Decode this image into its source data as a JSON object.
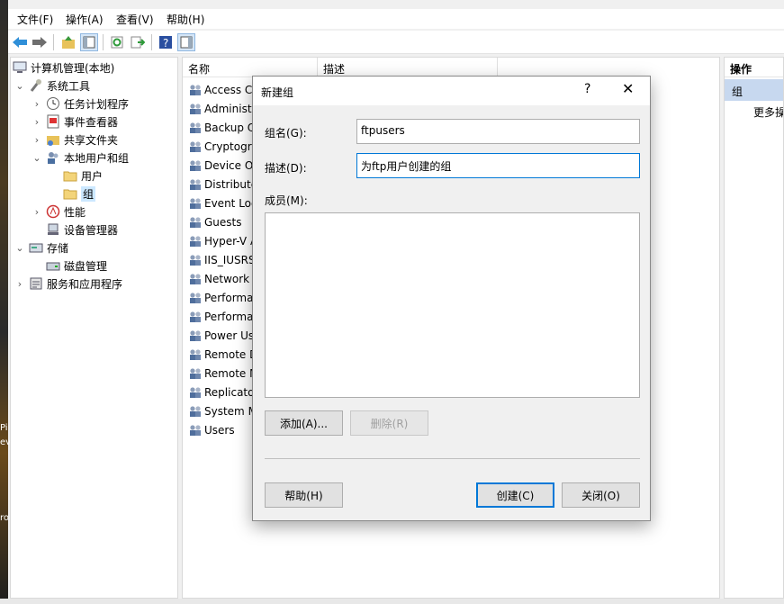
{
  "menubar": {
    "file": "文件(F)",
    "action": "操作(A)",
    "view": "查看(V)",
    "help": "帮助(H)"
  },
  "toolbar": {
    "icons": [
      "back-arrow-icon",
      "forward-arrow-icon",
      "up-folder-icon",
      "show-hide-tree-icon",
      "refresh-icon",
      "export-list-icon",
      "help-icon",
      "show-hide-action-pane-icon"
    ]
  },
  "tree": {
    "root": "计算机管理(本地)",
    "system_tools": "系统工具",
    "task_scheduler": "任务计划程序",
    "event_viewer": "事件查看器",
    "shared_folders": "共享文件夹",
    "local_users_groups": "本地用户和组",
    "users": "用户",
    "groups": "组",
    "performance": "性能",
    "device_manager": "设备管理器",
    "storage": "存储",
    "disk_management": "磁盘管理",
    "services_apps": "服务和应用程序"
  },
  "list": {
    "col_name": "名称",
    "col_desc": "描述",
    "rows": [
      "Access Co",
      "Administr",
      "Backup O",
      "Cryptogra",
      "Device Ov",
      "Distribute",
      "Event Log",
      "Guests",
      "Hyper-V A",
      "IIS_IUSRS",
      "Network",
      "Performa",
      "Performa",
      "Power Us",
      "Remote D",
      "Remote M",
      "Replicato",
      "System M",
      "Users"
    ]
  },
  "actions": {
    "header": "操作",
    "section": "组",
    "more": "更多操"
  },
  "dialog": {
    "title": "新建组",
    "help_glyph": "?",
    "close_glyph": "✕",
    "group_name_label": "组名(G):",
    "group_name_value": "ftpusers",
    "description_label": "描述(D):",
    "description_value": "为ftp用户创建的组",
    "members_label": "成员(M):",
    "add_button": "添加(A)...",
    "remove_button": "删除(R)",
    "help_button": "帮助(H)",
    "create_button": "创建(C)",
    "close_button": "关闭(O)"
  },
  "desktop_strip": {
    "text1": "Pi",
    "text2": "ev",
    "text3": "ro"
  }
}
